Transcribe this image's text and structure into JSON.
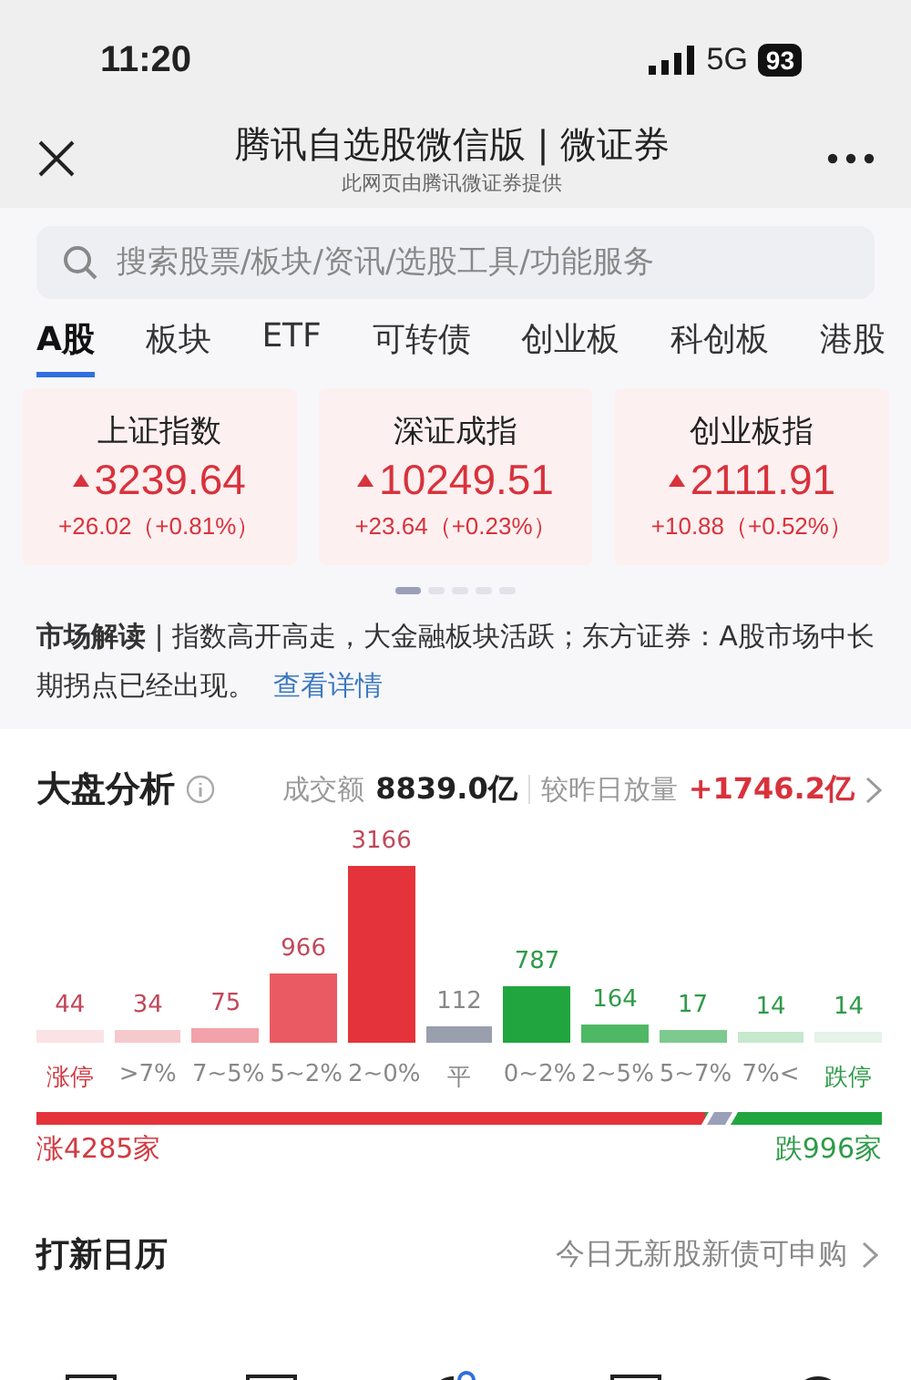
{
  "status_bar": {
    "time": "11:20",
    "network": "5G",
    "battery": "93"
  },
  "header": {
    "title": "腾讯自选股微信版 | 微证券",
    "subtitle": "此网页由腾讯微证券提供"
  },
  "search": {
    "placeholder": "搜索股票/板块/资讯/选股工具/功能服务"
  },
  "tabs": [
    {
      "label": "A股",
      "selected": true
    },
    {
      "label": "板块",
      "selected": false
    },
    {
      "label": "ETF",
      "selected": false
    },
    {
      "label": "可转债",
      "selected": false
    },
    {
      "label": "创业板",
      "selected": false
    },
    {
      "label": "科创板",
      "selected": false
    },
    {
      "label": "港股",
      "selected": false
    }
  ],
  "indices": [
    {
      "name": "上证指数",
      "value": "3239.64",
      "change": "+26.02（+0.81%）"
    },
    {
      "name": "深证成指",
      "value": "10249.51",
      "change": "+23.64（+0.23%）"
    },
    {
      "name": "创业板指",
      "value": "2111.91",
      "change": "+10.88（+0.52%）"
    }
  ],
  "pager": [
    {
      "selected": true
    },
    {
      "selected": false
    },
    {
      "selected": false
    },
    {
      "selected": false
    },
    {
      "selected": false
    }
  ],
  "commentary": {
    "text": "**市场解读** | 指数高开高走，大金融板块活跃；东方证券：A股市场中长期拐点已经出现。",
    "link": "查看详情"
  },
  "analysis": {
    "title": "大盘分析",
    "turnover_label": "成交额",
    "turnover": "8839.0亿",
    "compare_label": "较昨日放量",
    "compare": "+1746.2亿",
    "distribution": [
      {
        "label": "涨停",
        "count": "44",
        "color": "#fbe3e5"
      },
      {
        "label": ">7%",
        "count": "34",
        "color": "#f6c9cd"
      },
      {
        "label": "7~5%",
        "count": "75",
        "color": "#f2a2a8"
      },
      {
        "label": "5~2%",
        "count": "966",
        "color": "#ea5a62"
      },
      {
        "label": "2~0%",
        "count": "3166",
        "color": "#e5333b"
      },
      {
        "label": "平",
        "count": "112",
        "color": "#9a9fae"
      },
      {
        "label": "0~2%",
        "count": "787",
        "color": "#21a63f"
      },
      {
        "label": "2~5%",
        "count": "164",
        "color": "#4fb865"
      },
      {
        "label": "5~7%",
        "count": "17",
        "color": "#7dca8e"
      },
      {
        "label": "7%<",
        "count": "14",
        "color": "#c6e8cd"
      },
      {
        "label": "跌停",
        "count": "14",
        "color": "#e6f3e8"
      }
    ],
    "breadth": {
      "level": 0.79,
      "up": "涨4285家",
      "down": "跌996家"
    }
  },
  "calendar": {
    "title": "打新日历",
    "note": "今日无新股新债可申购"
  }
}
